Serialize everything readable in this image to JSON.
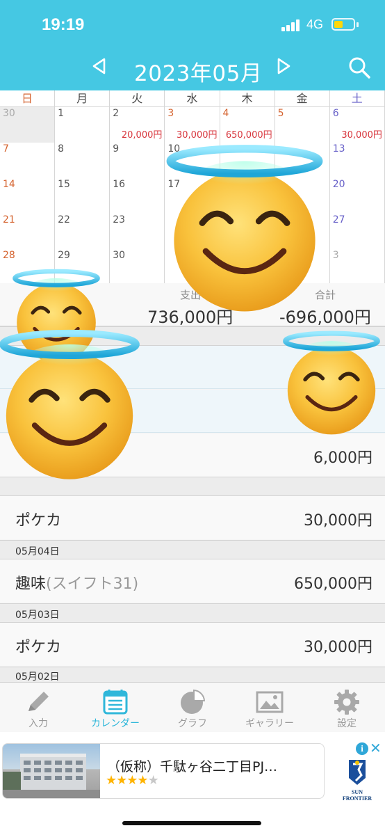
{
  "status_bar": {
    "time": "19:19",
    "network": "4G"
  },
  "header": {
    "prev_icon": "triangle-left-icon",
    "title": "2023年05月",
    "next_icon": "triangle-right-icon",
    "search_icon": "magnifier-icon"
  },
  "calendar": {
    "weekdays": [
      "日",
      "月",
      "火",
      "水",
      "木",
      "金",
      "土"
    ],
    "weeks": [
      [
        {
          "d": "30",
          "amt": ""
        },
        {
          "d": "1",
          "amt": ""
        },
        {
          "d": "2",
          "amt": "20,000円"
        },
        {
          "d": "3",
          "amt": "30,000円"
        },
        {
          "d": "4",
          "amt": "650,000円"
        },
        {
          "d": "5",
          "amt": ""
        },
        {
          "d": "6",
          "amt": "30,000円"
        }
      ],
      [
        {
          "d": "7",
          "amt": ""
        },
        {
          "d": "8",
          "amt": ""
        },
        {
          "d": "9",
          "amt": ""
        },
        {
          "d": "10",
          "amt": ""
        },
        {
          "d": "",
          "amt": ""
        },
        {
          "d": "",
          "amt": ""
        },
        {
          "d": "13",
          "amt": ""
        }
      ],
      [
        {
          "d": "14",
          "amt": ""
        },
        {
          "d": "15",
          "amt": ""
        },
        {
          "d": "16",
          "amt": ""
        },
        {
          "d": "17",
          "amt": ""
        },
        {
          "d": "",
          "amt": ""
        },
        {
          "d": "",
          "amt": ""
        },
        {
          "d": "20",
          "amt": ""
        }
      ],
      [
        {
          "d": "21",
          "amt": ""
        },
        {
          "d": "22",
          "amt": ""
        },
        {
          "d": "23",
          "amt": ""
        },
        {
          "d": "",
          "amt": ""
        },
        {
          "d": "",
          "amt": ""
        },
        {
          "d": "",
          "amt": ""
        },
        {
          "d": "27",
          "amt": ""
        }
      ],
      [
        {
          "d": "28",
          "amt": ""
        },
        {
          "d": "29",
          "amt": ""
        },
        {
          "d": "30",
          "amt": ""
        },
        {
          "d": "",
          "amt": ""
        },
        {
          "d": "",
          "amt": ""
        },
        {
          "d": "",
          "amt": ""
        },
        {
          "d": "3",
          "amt": ""
        }
      ]
    ]
  },
  "summary": {
    "expense_label": "支出",
    "expense_value": "736,000円",
    "total_label": "合計",
    "total_value": "-696,000円"
  },
  "list": {
    "partial_entry_amount": "6,000円",
    "sections": [
      {
        "date": "",
        "label": "ポケカ",
        "sub": "",
        "amount": "30,000円"
      },
      {
        "date": "05月04日",
        "label": "趣味",
        "sub": "(スイフト31)",
        "amount": "650,000円"
      },
      {
        "date": "05月03日",
        "label": "ポケカ",
        "sub": "",
        "amount": "30,000円"
      },
      {
        "date": "05月02日",
        "label": "",
        "sub": "",
        "amount": ""
      }
    ]
  },
  "tabs": [
    {
      "label": "入力",
      "icon": "pencil-icon",
      "active": false
    },
    {
      "label": "カレンダー",
      "icon": "calendar-icon",
      "active": true
    },
    {
      "label": "グラフ",
      "icon": "pie-chart-icon",
      "active": false
    },
    {
      "label": "ギャラリー",
      "icon": "gallery-icon",
      "active": false
    },
    {
      "label": "設定",
      "icon": "gear-icon",
      "active": false
    }
  ],
  "ad": {
    "title": "（仮称）千駄ヶ谷二丁目PJ…",
    "stars": "★★★★★",
    "rating": 4,
    "info_icon": "i",
    "close_icon": "✕",
    "logo_text": "SUN FRONTIER"
  },
  "overlay": {
    "emoji": "smiling-face-with-halo"
  },
  "colors": {
    "header_bg": "#45c8e3",
    "accent": "#2fb7da",
    "amount_red": "#d8363d",
    "sunday": "#d56430",
    "saturday": "#6760c8",
    "star": "#ffb400"
  }
}
